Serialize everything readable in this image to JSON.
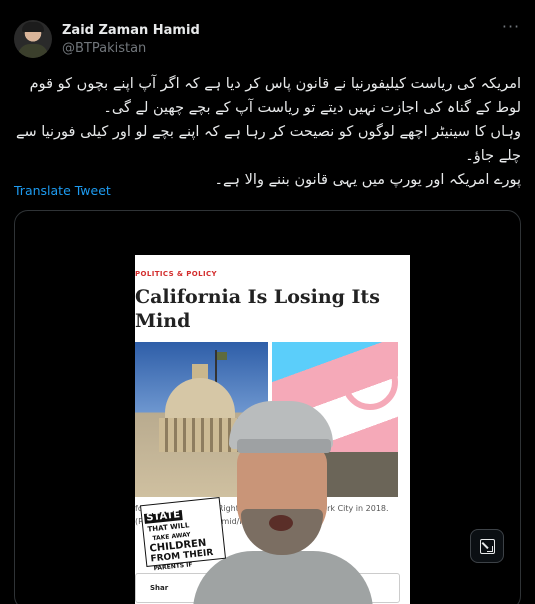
{
  "author": {
    "display_name": "Zaid Zaman Hamid",
    "handle": "@BTPakistan"
  },
  "more_icon": "more-horizontal-icon",
  "tweet": {
    "lines": [
      "امریکہ کی ریاست کیلیفورنیا نے قانون پاس کر دیا ہے کہ اگر آپ اپنے بچوں کو قوم لوط کے گناہ کی اجازت نہیں دیتے تو ریاست آپ کے بچے چھین لے گی۔",
      "وہاں کا سینیٹر اچھے لوگوں کو نصیحت کر رہا ہے کہ اپنے بچے لو اور کیلی فورنیا سے چلے جاؤ۔",
      "پورے امریکہ اور یورپ میں یہی قانون بننے والا ہے۔"
    ]
  },
  "translate_label": "Translate Tweet",
  "media": {
    "article": {
      "kicker": "POLITICS & POLICY",
      "title": "California Is Losing Its Mind",
      "caption": "fornia Stat... mento. Right: ...der flag at a p... York City in 2018. (R...Getty Im... McDermid/Reuters)",
      "share_label": "Shar"
    },
    "sticker": {
      "line1": "STATE",
      "line2": "THAT WILL",
      "line3": "TAKE AWAY",
      "line4": "CHILDREN",
      "line5": "FROM THEIR",
      "line6": "PARENTS IF"
    },
    "expand_icon": "expand-icon"
  }
}
